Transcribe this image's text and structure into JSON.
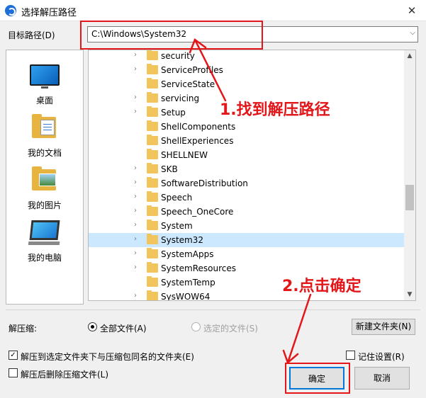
{
  "window": {
    "title": "选择解压路径",
    "close_glyph": "✕"
  },
  "path": {
    "label": "目标路径(D)",
    "value": "C:\\Windows\\System32",
    "dropdown_glyph": "⌵"
  },
  "places": [
    {
      "label": "桌面",
      "icon": "desktop-icon"
    },
    {
      "label": "我的文档",
      "icon": "documents-icon"
    },
    {
      "label": "我的图片",
      "icon": "pictures-icon"
    },
    {
      "label": "我的电脑",
      "icon": "computer-icon"
    }
  ],
  "tree": {
    "expand_glyph": "›",
    "items": [
      {
        "name": "security",
        "expandable": true
      },
      {
        "name": "ServiceProfiles",
        "expandable": true
      },
      {
        "name": "ServiceState",
        "expandable": false
      },
      {
        "name": "servicing",
        "expandable": true
      },
      {
        "name": "Setup",
        "expandable": true
      },
      {
        "name": "ShellComponents",
        "expandable": false
      },
      {
        "name": "ShellExperiences",
        "expandable": false
      },
      {
        "name": "SHELLNEW",
        "expandable": false
      },
      {
        "name": "SKB",
        "expandable": true
      },
      {
        "name": "SoftwareDistribution",
        "expandable": true
      },
      {
        "name": "Speech",
        "expandable": true
      },
      {
        "name": "Speech_OneCore",
        "expandable": true
      },
      {
        "name": "System",
        "expandable": true
      },
      {
        "name": "System32",
        "expandable": true,
        "selected": true
      },
      {
        "name": "SystemApps",
        "expandable": true
      },
      {
        "name": "SystemResources",
        "expandable": true
      },
      {
        "name": "SystemTemp",
        "expandable": false
      },
      {
        "name": "SysWOW64",
        "expandable": true
      }
    ]
  },
  "scrollbar": {
    "up_glyph": "▲",
    "down_glyph": "▼"
  },
  "options": {
    "extract_label": "解压缩:",
    "radio_all": "全部文件(A)",
    "radio_selected": "选定的文件(S)",
    "new_folder": "新建文件夹(N)",
    "check_extract_to_folder": "解压到选定文件夹下与压缩包同名的文件夹(E)",
    "check_delete_after": "解压后删除压缩文件(L)",
    "check_remember": "记住设置(R)",
    "check_glyph": "✓"
  },
  "buttons": {
    "ok": "确定",
    "cancel": "取消"
  },
  "annotations": {
    "step1": "1.找到解压路径",
    "step2": "2.点击确定"
  },
  "colors": {
    "annotation": "#e3161a",
    "selection": "#cce8ff",
    "accent": "#0078d7"
  }
}
